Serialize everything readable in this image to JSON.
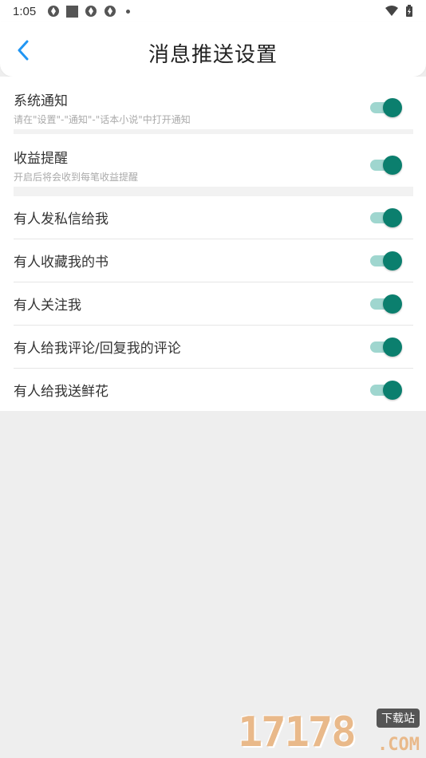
{
  "status_bar": {
    "time": "1:05"
  },
  "header": {
    "title": "消息推送设置"
  },
  "settings": [
    {
      "title": "系统通知",
      "subtitle": "请在\"设置\"-\"通知\"-\"话本小说\"中打开通知",
      "enabled": true
    },
    {
      "title": "收益提醒",
      "subtitle": "开启后将会收到每笔收益提醒",
      "enabled": true
    },
    {
      "title": "有人发私信给我",
      "enabled": true
    },
    {
      "title": "有人收藏我的书",
      "enabled": true
    },
    {
      "title": "有人关注我",
      "enabled": true
    },
    {
      "title": "有人给我评论/回复我的评论",
      "enabled": true
    },
    {
      "title": "有人给我送鲜花",
      "enabled": true
    }
  ],
  "watermark": {
    "number": "17178",
    "tag": "下载站",
    "suffix": ".COM"
  },
  "colors": {
    "accent": "#0b7f6e",
    "track": "#9fd6cf",
    "back_arrow": "#2196f3"
  }
}
